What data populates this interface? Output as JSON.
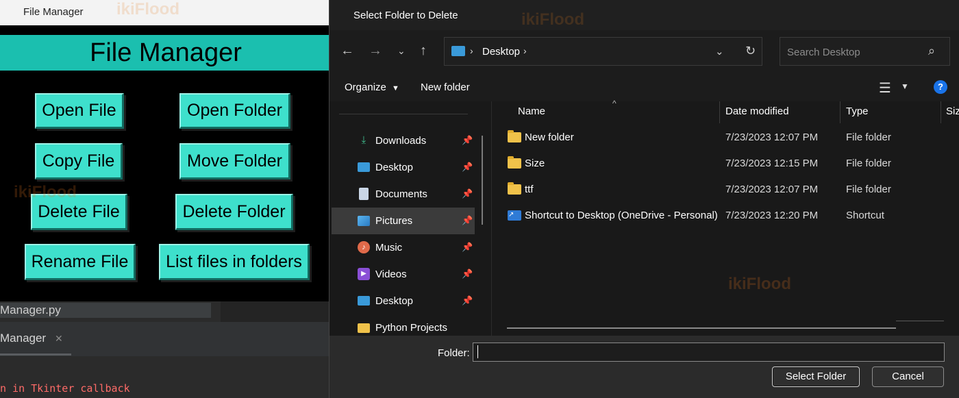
{
  "tk_window": {
    "title": "File Manager",
    "header": "File Manager",
    "buttons": [
      {
        "label": "Open File"
      },
      {
        "label": "Open Folder"
      },
      {
        "label": "Copy File"
      },
      {
        "label": "Move Folder"
      },
      {
        "label": "Delete File"
      },
      {
        "label": "Delete Folder"
      },
      {
        "label": "Rename File"
      },
      {
        "label": "List files in folders"
      }
    ],
    "header_color": "#1bbfaf",
    "button_color": "#3ee0cc"
  },
  "ide": {
    "file_tab": "Manager.py",
    "run_tab": "Manager",
    "console_line": "n in Tkinter callback"
  },
  "watermark": "ikiFlood",
  "dialog": {
    "title": "Select Folder to Delete",
    "address": {
      "crumb": "Desktop"
    },
    "search_placeholder": "Search Desktop",
    "toolbar": {
      "organize": "Organize",
      "new_folder": "New folder"
    },
    "nav_items": [
      {
        "label": "Downloads",
        "icon": "download-icon"
      },
      {
        "label": "Desktop",
        "icon": "desktop-icon"
      },
      {
        "label": "Documents",
        "icon": "document-icon"
      },
      {
        "label": "Pictures",
        "icon": "pictures-icon",
        "selected": true
      },
      {
        "label": "Music",
        "icon": "music-icon"
      },
      {
        "label": "Videos",
        "icon": "videos-icon"
      },
      {
        "label": "Desktop",
        "icon": "desktop-icon"
      },
      {
        "label": "Python Projects",
        "icon": "folder-icon"
      }
    ],
    "columns": {
      "name": "Name",
      "date": "Date modified",
      "type": "Type",
      "size": "Siz"
    },
    "rows": [
      {
        "name": "New folder",
        "date": "7/23/2023 12:07 PM",
        "type": "File folder",
        "icon": "folder-icon"
      },
      {
        "name": "Size",
        "date": "7/23/2023 12:15 PM",
        "type": "File folder",
        "icon": "folder-icon"
      },
      {
        "name": "ttf",
        "date": "7/23/2023 12:07 PM",
        "type": "File folder",
        "icon": "folder-icon"
      },
      {
        "name": "Shortcut to Desktop (OneDrive - Personal)",
        "date": "7/23/2023 12:20 PM",
        "type": "Shortcut",
        "icon": "shortcut-icon"
      }
    ],
    "folder_label": "Folder:",
    "folder_value": "",
    "select_button": "Select Folder",
    "cancel_button": "Cancel"
  }
}
